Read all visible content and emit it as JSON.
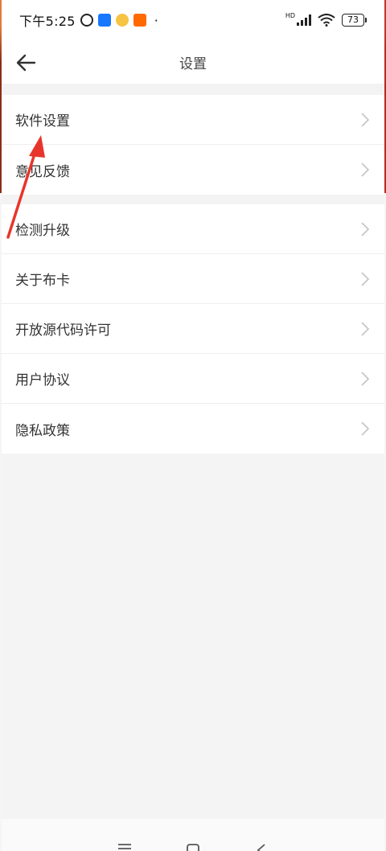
{
  "status_bar": {
    "time": "下午5:25",
    "battery": "73",
    "network": "HD"
  },
  "header": {
    "title": "设置",
    "back_icon": "arrow-left-icon"
  },
  "groups": [
    {
      "items": [
        {
          "label": "软件设置"
        },
        {
          "label": "意见反馈"
        }
      ]
    },
    {
      "items": [
        {
          "label": "检测升级"
        },
        {
          "label": "关于布卡"
        },
        {
          "label": "开放源代码许可"
        },
        {
          "label": "用户协议"
        },
        {
          "label": "隐私政策"
        }
      ]
    }
  ],
  "annotation": {
    "color": "#e8352b"
  },
  "colors": {
    "chevron": "#c4c4c4",
    "divider": "#eeeeee",
    "background": "#f5f5f5"
  }
}
